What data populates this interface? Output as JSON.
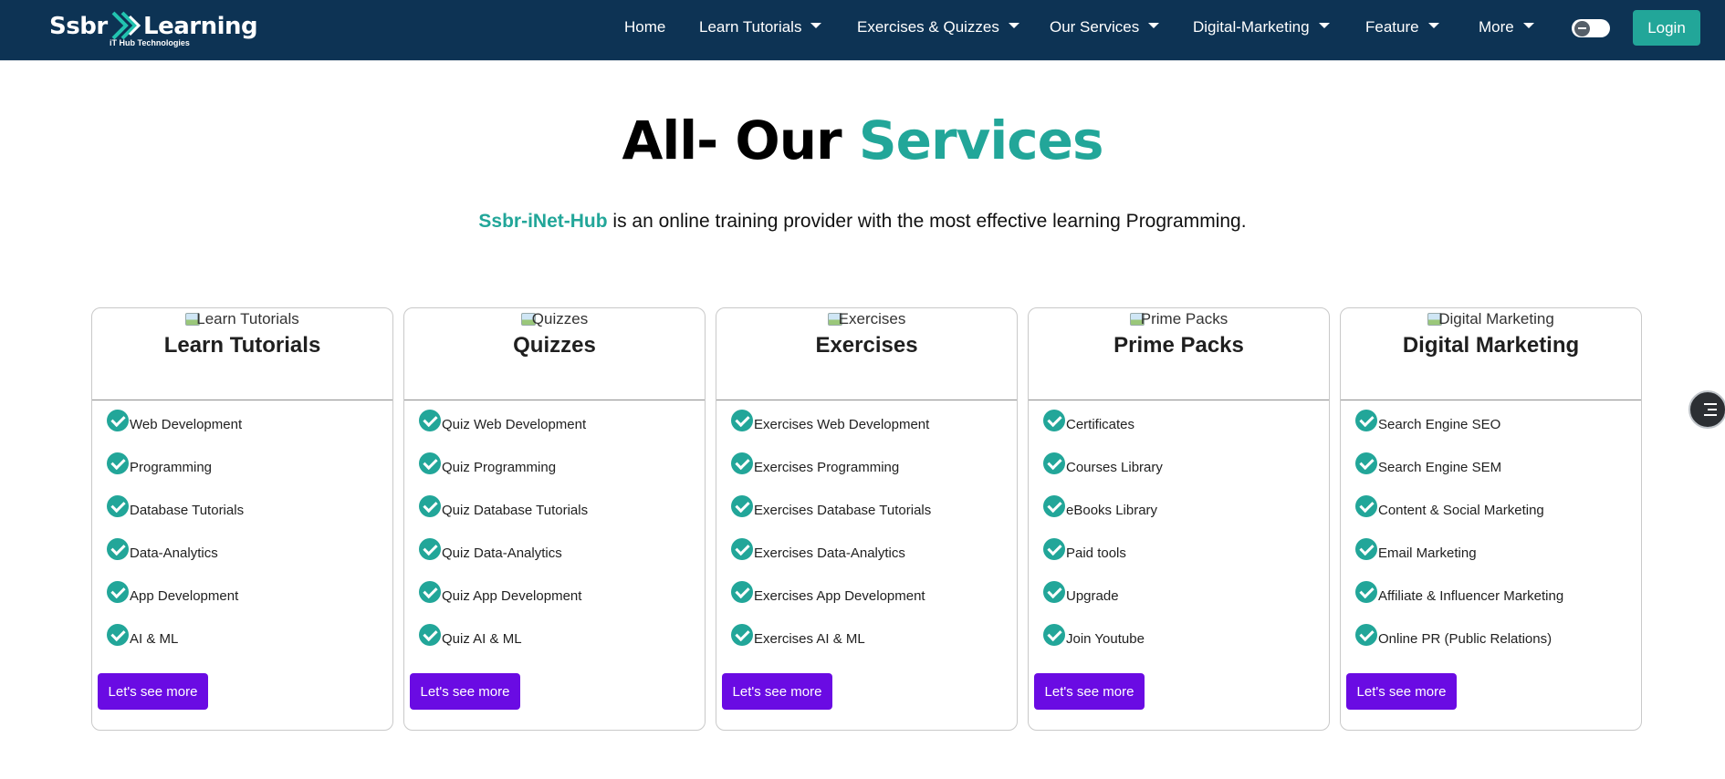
{
  "navbar": {
    "brand_left": "Ssbr",
    "brand_right": "Learning",
    "brand_tagline": "iT Hub Technologies",
    "items": [
      {
        "label": "Home",
        "has_dropdown": false
      },
      {
        "label": "Learn Tutorials",
        "has_dropdown": true
      },
      {
        "label": "Exercises & Quizzes",
        "has_dropdown": true
      },
      {
        "label": "Our Services",
        "has_dropdown": true
      },
      {
        "label": "Digital-Marketing",
        "has_dropdown": true
      },
      {
        "label": "Feature",
        "has_dropdown": true
      },
      {
        "label": "More",
        "has_dropdown": true
      }
    ],
    "login_label": "Login"
  },
  "hero": {
    "title_main": "All- Our ",
    "title_accent": "Services",
    "sub_brand": "Ssbr-iNet-Hub",
    "sub_text": " is an online training provider with the most effective learning Programming."
  },
  "cards": [
    {
      "img_alt": "Learn Tutorials",
      "title": "Learn Tutorials",
      "items": [
        "Web Development",
        "Programming",
        "Database Tutorials",
        "Data-Analytics",
        "App Development",
        "AI & ML"
      ],
      "button": "Let's see more"
    },
    {
      "img_alt": "Quizzes",
      "title": "Quizzes",
      "items": [
        "Quiz Web Development",
        "Quiz Programming",
        "Quiz Database Tutorials",
        "Quiz Data-Analytics",
        "Quiz App Development",
        "Quiz AI & ML"
      ],
      "button": "Let's see more"
    },
    {
      "img_alt": "Exercises",
      "title": "Exercises",
      "items": [
        "Exercises Web Development",
        "Exercises Programming",
        "Exercises Database Tutorials",
        "Exercises Data-Analytics",
        "Exercises App Development",
        "Exercises AI & ML"
      ],
      "button": "Let's see more"
    },
    {
      "img_alt": "Prime Packs",
      "title": "Prime Packs",
      "items": [
        "Certificates",
        "Courses Library",
        "eBooks Library",
        "Paid tools",
        "Upgrade",
        "Join Youtube"
      ],
      "button": "Let's see more"
    },
    {
      "img_alt": "Digital Marketing",
      "title": "Digital Marketing",
      "items": [
        "Search Engine SEO",
        "Search Engine SEM",
        "Content & Social Marketing",
        "Email Marketing",
        "Affiliate & Influencer Marketing",
        "Online PR (Public Relations)"
      ],
      "button": "Let's see more"
    }
  ],
  "icons": {
    "list_item": "check-circle-icon",
    "side_button": "sliders-icon"
  },
  "colors": {
    "navbar_bg": "#0d3354",
    "accent": "#22a699",
    "button": "#6a0be3"
  }
}
